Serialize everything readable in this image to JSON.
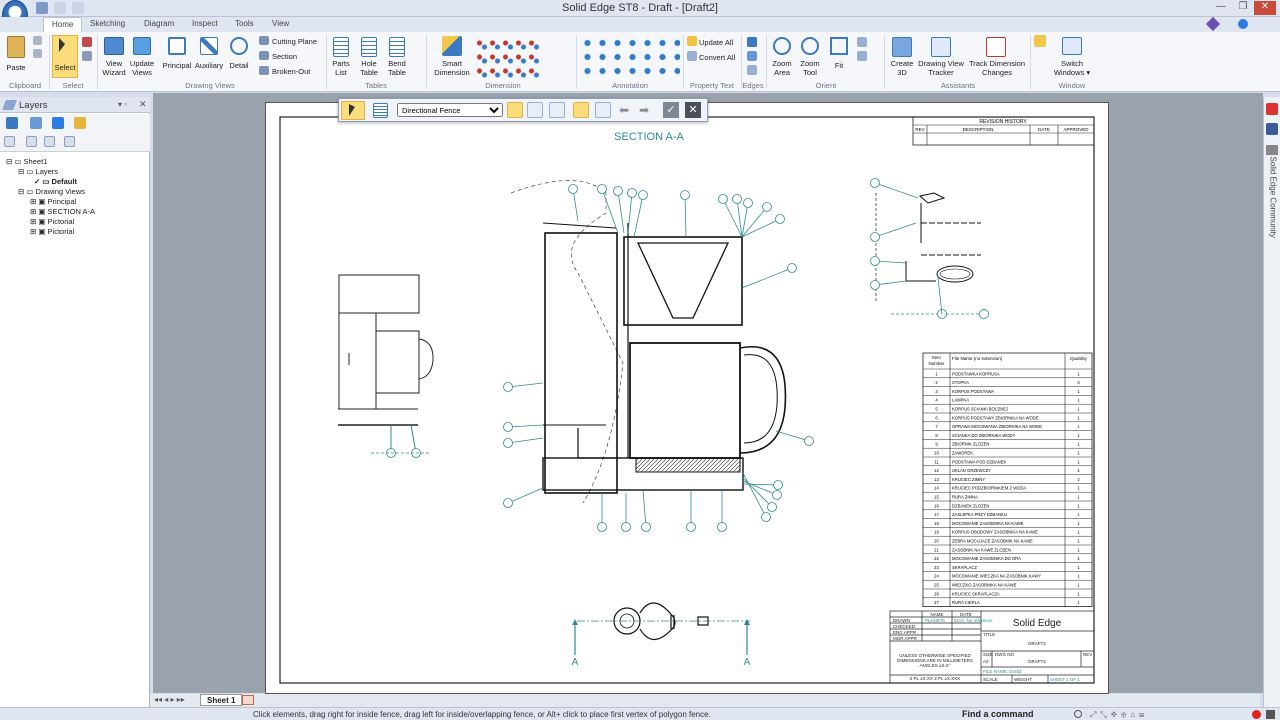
{
  "app": {
    "title": "Solid Edge ST8 - Draft - [Draft2]",
    "accent": "#2b7de1"
  },
  "tabs": [
    "Home",
    "Sketching",
    "Diagram",
    "Inspect",
    "Tools",
    "View"
  ],
  "ribbon": {
    "groups": {
      "clipboard": "Clipboard",
      "select": "Select",
      "drawing_views": "Drawing Views",
      "tables": "Tables",
      "dimension": "Dimension",
      "annotation": "Annotation",
      "property_text": "Property Text",
      "edges": "Edges",
      "orient": "Orient",
      "assistants": "Assistants",
      "window": "Window"
    },
    "buttons": {
      "paste": "Paste",
      "select": "Select",
      "view_wizard_1": "View",
      "view_wizard_2": "Wizard",
      "update_views_1": "Update",
      "update_views_2": "Views",
      "principal": "Principal",
      "auxiliary": "Auxiliary",
      "detail": "Detail",
      "cutting_plane": "Cutting Plane",
      "section": "Section",
      "broken_out": "Broken-Out",
      "parts_list_1": "Parts",
      "parts_list_2": "List",
      "hole_table_1": "Hole",
      "hole_table_2": "Table",
      "bend_table_1": "Bend",
      "bend_table_2": "Table",
      "smart_dim_1": "Smart",
      "smart_dim_2": "Dimension",
      "update_all": "Update All",
      "convert_all": "Convert All",
      "zoom_area_1": "Zoom",
      "zoom_area_2": "Area",
      "zoom_tool_1": "Zoom",
      "zoom_tool_2": "Tool",
      "fit": "Fit",
      "create_3d_1": "Create",
      "create_3d_2": "3D",
      "dvt_1": "Drawing View",
      "dvt_2": "Tracker",
      "tdc_1": "Track Dimension",
      "tdc_2": "Changes",
      "switch_1": "Switch",
      "switch_2": "Windows"
    }
  },
  "layers_panel": {
    "title": "Layers",
    "tree": {
      "sheet": "Sheet1",
      "layers": "Layers",
      "default": "Default",
      "drawing_views": "Drawing Views",
      "views": [
        "Principal",
        "SECTION A-A",
        "Pictorial",
        "Pictorial"
      ]
    }
  },
  "fence_bar": {
    "selected": "Directional Fence"
  },
  "drawing": {
    "section_title": "SECTION A-A",
    "section_mark": "A",
    "revision": {
      "title": "REVISION HISTORY",
      "cols": [
        "REV",
        "DESCRIPTION",
        "DATE",
        "APPROVED"
      ]
    },
    "parts_list": {
      "headers": [
        "Item Number",
        "File Name (no extension)",
        "Quantity"
      ],
      "rows": [
        [
          "1",
          "PODSTAWKA KOPRUSA",
          "1"
        ],
        [
          "2",
          "STOPKA",
          "3"
        ],
        [
          "3",
          "KORPUS PODSTAWA",
          "1"
        ],
        [
          "4",
          "LAMPKA",
          "1"
        ],
        [
          "5",
          "KORPUS SCIANKI BOCZNEJ",
          "1"
        ],
        [
          "6",
          "KORPUS PODSTAWY ZBIORNIKA NA WODE",
          "1"
        ],
        [
          "7",
          "OPRAWA MOCOWANIA ZBIORNIKA NA WODE",
          "1"
        ],
        [
          "8",
          "SCIANKA DO ZBIORNIKA WODY",
          "1"
        ],
        [
          "9",
          "ZBIORNIK ZLOZEN",
          "1"
        ],
        [
          "10",
          "ZAWOREK",
          "1"
        ],
        [
          "11",
          "PODSTAWA POD DZBANEK",
          "1"
        ],
        [
          "12",
          "UKLAD GRZEWCZY",
          "1"
        ],
        [
          "13",
          "KRUCIEC ZIMNY",
          "2"
        ],
        [
          "14",
          "KRUCIEC PODZBIORNIKIEM Z WODA",
          "1"
        ],
        [
          "15",
          "RURA ZIMNA",
          "1"
        ],
        [
          "16",
          "DZBANEK ZLOZEN",
          "1"
        ],
        [
          "17",
          "ZASLEPKA PRZY DZBANKU",
          "1"
        ],
        [
          "18",
          "MOCOWANIE ZASOBNIKA NA KAWE",
          "1"
        ],
        [
          "19",
          "KORPUS OBUDOWY ZASOBNIKA NA KAWE",
          "1"
        ],
        [
          "20",
          "ZEBRA MOCUJACE ZASOBNIK NA KAWE",
          "1"
        ],
        [
          "21",
          "ZASOBNIK NA KAWE ZLOZEN",
          "1"
        ],
        [
          "22",
          "MOCOWANIE ZASOBNIKA DO DRA",
          "1"
        ],
        [
          "23",
          "SKRAPLACZ",
          "1"
        ],
        [
          "24",
          "MOCOWANIE WIECZKA NA ZASOBNIK KAWY",
          "1"
        ],
        [
          "25",
          "WIECZKO ZASOBNIKA NA KAWE",
          "1"
        ],
        [
          "26",
          "KRUCIEC SKRAPLACZA",
          "1"
        ],
        [
          "27",
          "RURA CIEPLA",
          "1"
        ]
      ]
    },
    "title_block": {
      "company": "Solid Edge",
      "labels": [
        "DRAWN",
        "CHECKED",
        "ENG APPR",
        "MGR APPR"
      ],
      "name_col": "NAME",
      "date_col": "DATE",
      "drawn_by": "PLANETA",
      "date_value": "Error: No reference",
      "title_label": "TITLE",
      "doc_title": "DRAFT2",
      "notes": [
        "UNLESS OTHERWISE SPECIFIED",
        "DIMENSIONS ARE IN MILLIMETERS",
        "ANGLES ±X.X°",
        "2 PL ±X.XX 3 PL ±X.XXX"
      ],
      "size_label": "SIZE",
      "size_value": "A2",
      "dwg_label": "DWG NO",
      "dwg_value": "DRAFT2",
      "rev_label": "REV",
      "file_label": "FILE NAME: Draft2",
      "scale_label": "SCALE",
      "weight_label": "WEIGHT",
      "sheet_label": "SHEET 1 OF 1"
    }
  },
  "sheet_tab": "Sheet 1",
  "status": {
    "prompt": "Click elements, drag right for inside fence, drag left for inside/overlapping fence, or Alt+ click to place first vertex of polygon fence.",
    "find_command": "Find a command"
  },
  "right_bar": {
    "label": "Solid Edge Community"
  }
}
